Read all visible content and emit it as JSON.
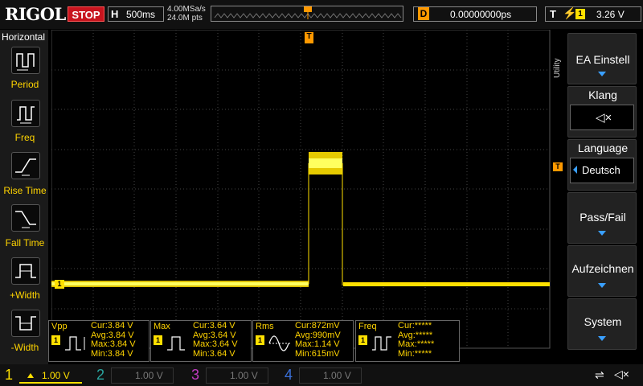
{
  "header": {
    "brand": "RIGOL",
    "run_state": "STOP",
    "h_label": "H",
    "timebase": "500ms",
    "sample_rate": "4.00MSa/s",
    "mem_depth": "24.0M pts",
    "delay_label": "D",
    "delay_value": "0.00000000ps",
    "trigger_label": "T",
    "trigger_channel": "1",
    "trigger_level": "3.26 V"
  },
  "left_panel": {
    "title": "Horizontal",
    "items": [
      {
        "label": "Period"
      },
      {
        "label": "Freq"
      },
      {
        "label": "Rise Time"
      },
      {
        "label": "Fall Time"
      },
      {
        "label": "+Width"
      },
      {
        "label": "-Width"
      }
    ]
  },
  "right_panel": {
    "tab": "Utility",
    "buttons": [
      {
        "label": "EA Einstell"
      },
      {
        "label": "Klang"
      },
      {
        "label": "Language",
        "value": "Deutsch"
      },
      {
        "label": "Pass/Fail"
      },
      {
        "label": "Aufzeichnen"
      },
      {
        "label": "System"
      }
    ]
  },
  "markers": {
    "trigger_pos": "T",
    "ch1_marker": "1",
    "trig_level_marker": "T"
  },
  "measurements": [
    {
      "name": "Vpp",
      "ch": "1",
      "cur": "Cur:3.84 V",
      "avg": "Avg:3.84 V",
      "max": "Max:3.84 V",
      "min": "Min:3.84 V"
    },
    {
      "name": "Max",
      "ch": "1",
      "cur": "Cur:3.64 V",
      "avg": "Avg:3.64 V",
      "max": "Max:3.64 V",
      "min": "Min:3.64 V"
    },
    {
      "name": "Rms",
      "ch": "1",
      "cur": "Cur:872mV",
      "avg": "Avg:990mV",
      "max": "Max:1.14 V",
      "min": "Min:615mV"
    },
    {
      "name": "Freq",
      "ch": "1",
      "cur": "Cur:*****",
      "avg": "Avg:*****",
      "max": "Max:*****",
      "min": "Min:*****"
    }
  ],
  "channels": [
    {
      "num": "1",
      "scale": "1.00 V",
      "color": "#ffe000"
    },
    {
      "num": "2",
      "scale": "1.00 V",
      "color": "#2aa6a0"
    },
    {
      "num": "3",
      "scale": "1.00 V",
      "color": "#c03ac0"
    },
    {
      "num": "4",
      "scale": "1.00 V",
      "color": "#3a6fd8"
    }
  ],
  "colors": {
    "ch1": "#ffe000",
    "accent": "#f90",
    "stop": "#c8141e",
    "arrow": "#3aa0ff"
  }
}
